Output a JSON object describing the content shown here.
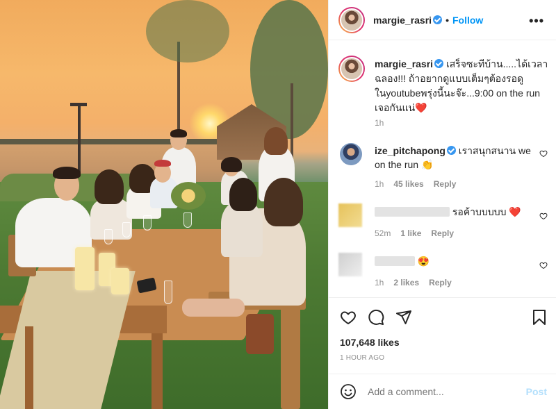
{
  "post": {
    "username": "margie_rasri",
    "separator": "•",
    "follow_label": "Follow",
    "more_label": "•••",
    "caption": {
      "username": "margie_rasri",
      "text": "เสร็จซะทีบ้าน.....ได้เวลาฉลอง!!! ถ้าอยากดูแบบเต็มๆต้องรอดูในyoutubeพรุ่งนี้นะจ๊ะ...9:00 on the run เจอกันแน่❤️",
      "age": "1h"
    },
    "comments": [
      {
        "username": "ize_pitchapong",
        "text": "เราสนุกสนาน we on the run 👏",
        "age": "1h",
        "likes": "45 likes",
        "reply_label": "Reply"
      },
      {
        "username": "",
        "text": "รอค้าบบบบบ ❤️",
        "age": "52m",
        "likes": "1 like",
        "reply_label": "Reply"
      },
      {
        "username": "",
        "text": "😍",
        "age": "1h",
        "likes": "2 likes",
        "reply_label": "Reply"
      }
    ],
    "likes_count": "107,648 likes",
    "timestamp": "1 HOUR AGO",
    "add_comment_placeholder": "Add a comment...",
    "post_label": "Post"
  },
  "icons": {
    "like": "heart-icon",
    "comment": "comment-icon",
    "share": "paper-plane-icon",
    "save": "bookmark-icon",
    "emoji": "emoji-icon",
    "more": "more-options-icon",
    "verified": "verified-badge-icon"
  },
  "colors": {
    "accent": "#0095f6",
    "verified": "#3897f0",
    "muted": "#8e8e8e",
    "post_disabled": "#b2dffc",
    "heart_red": "#ed4956"
  }
}
